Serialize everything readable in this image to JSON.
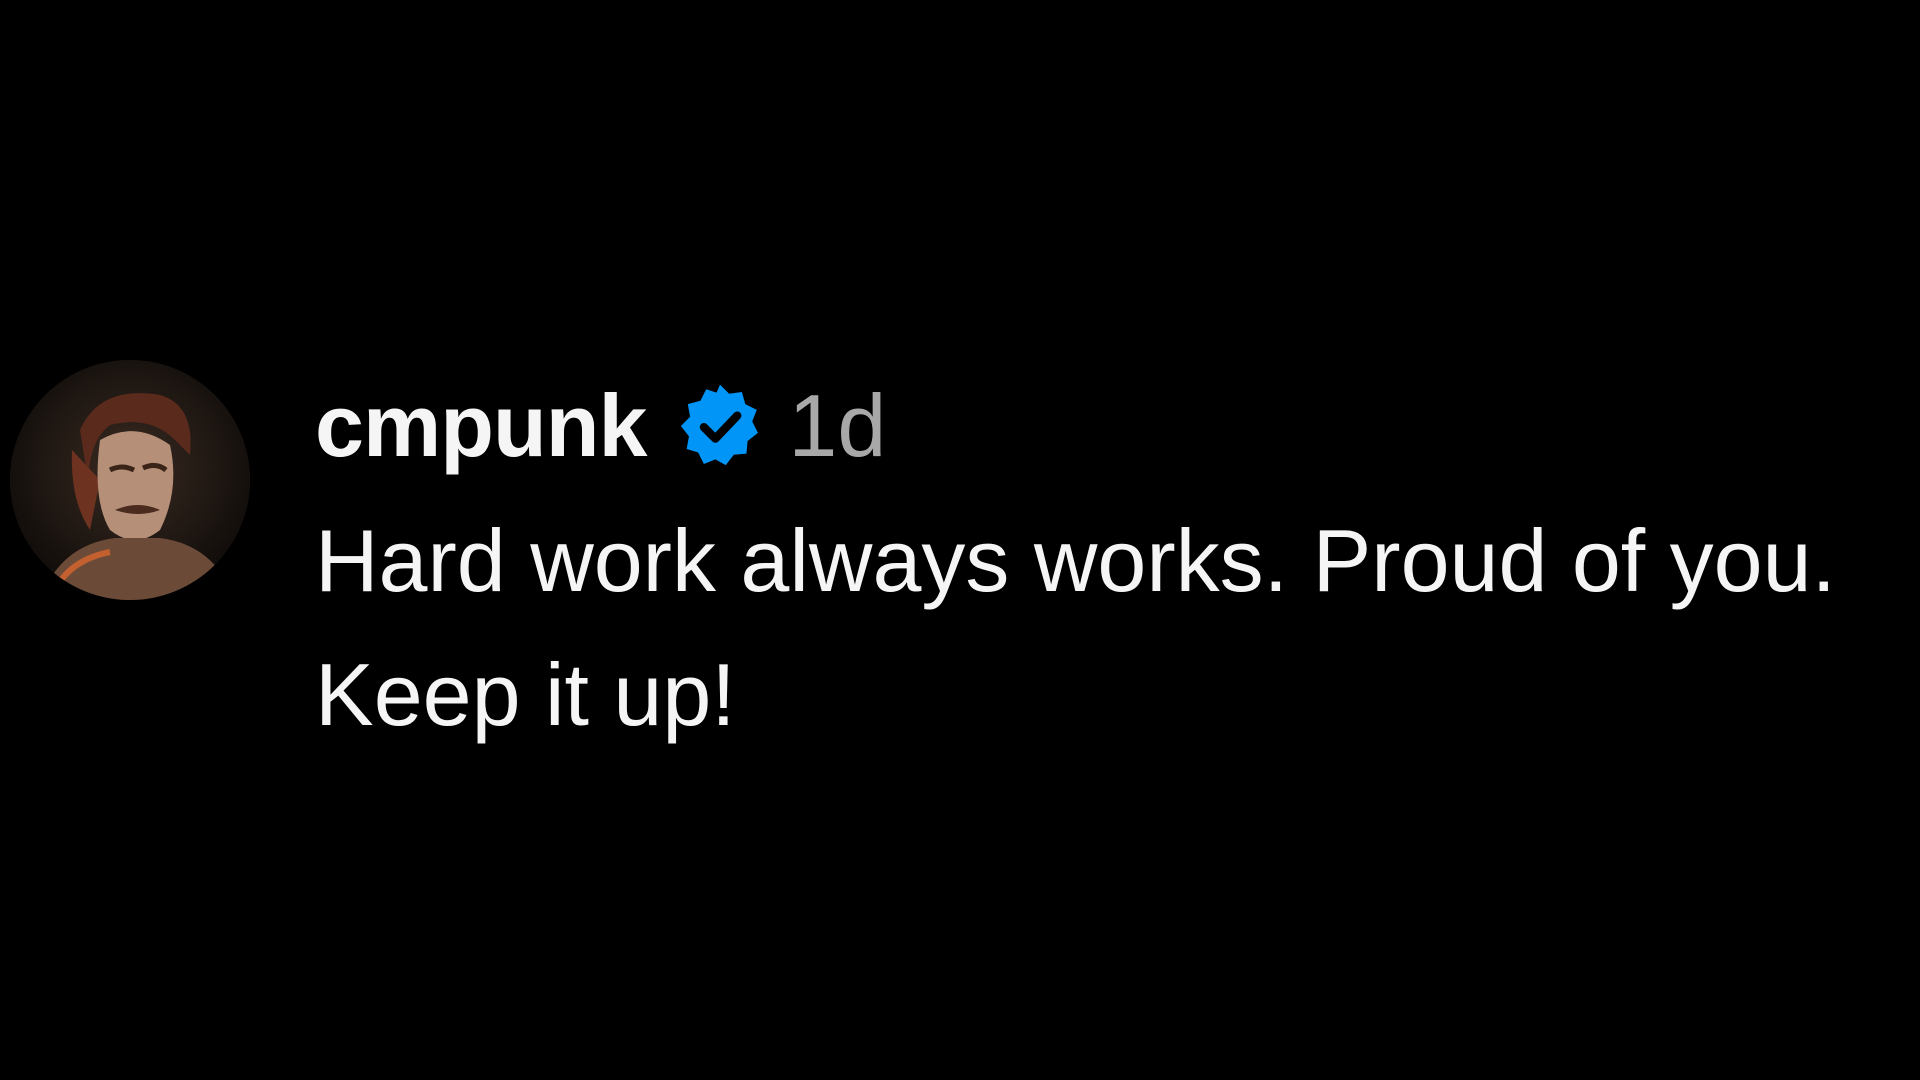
{
  "comment": {
    "username": "cmpunk",
    "verified_icon": "verified-badge-icon",
    "verified_color": "#0095f6",
    "time": "1d",
    "text": "Hard work always works. Proud of you. Keep it up!",
    "avatar_icon": "profile-photo"
  }
}
